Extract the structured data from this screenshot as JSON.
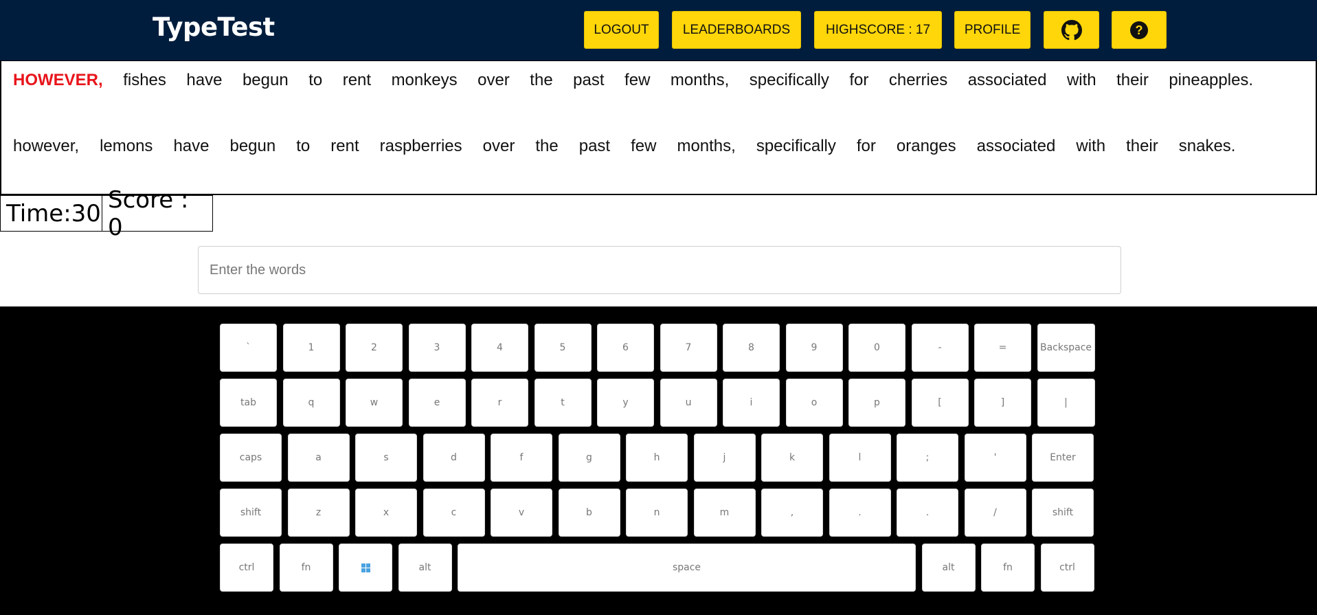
{
  "app": {
    "title": "TypeTest"
  },
  "nav": {
    "logout_label": "LOGOUT",
    "leaderboards_label": "LEADERBOARDS",
    "highscore_label": "HIGHSCORE : 17",
    "profile_label": "PROFILE",
    "github_icon": "github-icon",
    "help_icon": "question-circle-icon"
  },
  "sentences": [
    [
      "HOWEVER,",
      "fishes",
      "have",
      "begun",
      "to",
      "rent",
      "monkeys",
      "over",
      "the",
      "past",
      "few",
      "months,",
      "specifically",
      "for",
      "cherries",
      "associated",
      "with",
      "their",
      "pineapples."
    ],
    [
      "however,",
      "lemons",
      "have",
      "begun",
      "to",
      "rent",
      "raspberries",
      "over",
      "the",
      "past",
      "few",
      "months,",
      "specifically",
      "for",
      "oranges",
      "associated",
      "with",
      "their",
      "snakes."
    ]
  ],
  "current_word_index": 0,
  "stats": {
    "time_text": "Time:30",
    "score_text": "Score : 0"
  },
  "input": {
    "placeholder": "Enter the words",
    "value": ""
  },
  "keyboard": {
    "rows": [
      [
        "`",
        "1",
        "2",
        "3",
        "4",
        "5",
        "6",
        "7",
        "8",
        "9",
        "0",
        "-",
        "=",
        "Backspace"
      ],
      [
        "tab",
        "q",
        "w",
        "e",
        "r",
        "t",
        "y",
        "u",
        "i",
        "o",
        "p",
        "[",
        "]",
        "|"
      ],
      [
        "caps",
        "a",
        "s",
        "d",
        "f",
        "g",
        "h",
        "j",
        "k",
        "l",
        ";",
        "'",
        "Enter"
      ],
      [
        "shift",
        "z",
        "x",
        "c",
        "v",
        "b",
        "n",
        "m",
        ",",
        ".",
        ".",
        "/",
        "shift"
      ],
      [
        "ctrl",
        "fn",
        "win",
        "alt",
        "space",
        "alt",
        "fn",
        "ctrl"
      ]
    ],
    "win_key_icon": "windows-logo-icon"
  },
  "colors": {
    "header_bg": "#001d3d",
    "button_bg": "#ffd60a",
    "current_word": "#e8151b",
    "keyboard_bg": "#000000"
  }
}
